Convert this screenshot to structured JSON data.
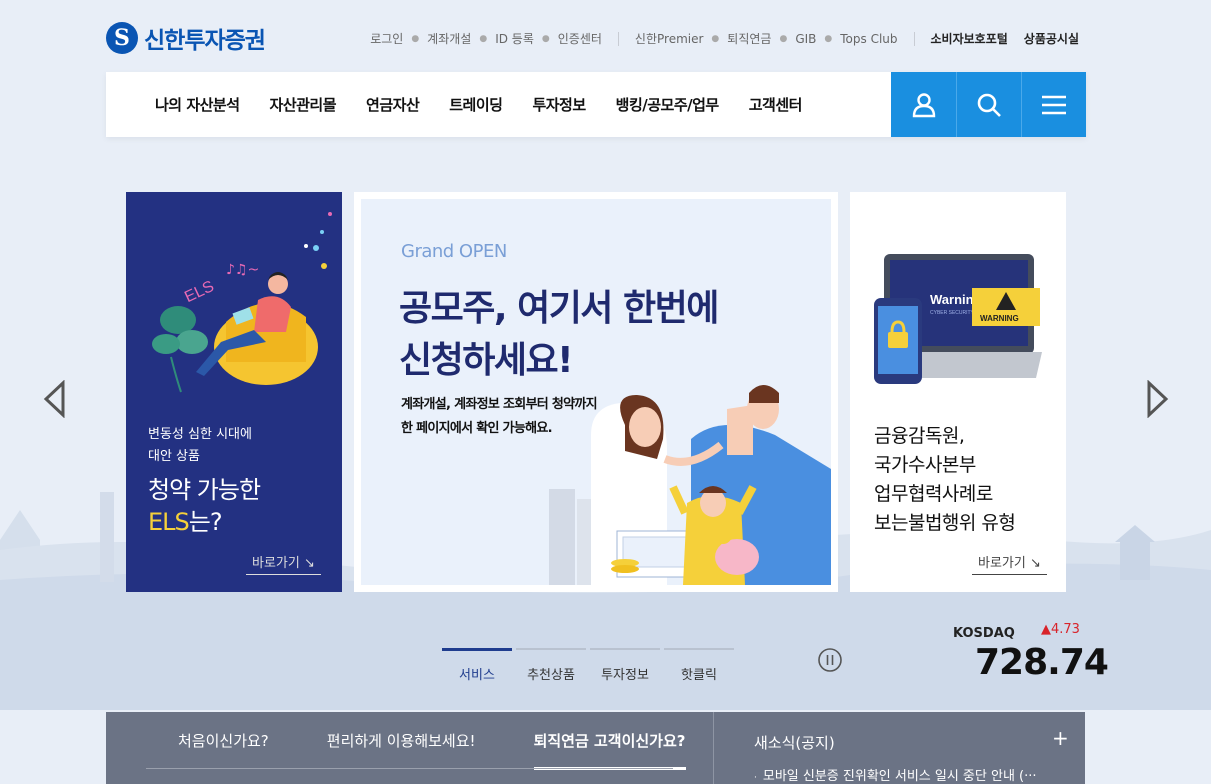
{
  "brand": {
    "logo_mark": "S",
    "name": "신한투자증권"
  },
  "util_links": [
    "로그인",
    "계좌개설",
    "ID 등록",
    "인증센터"
  ],
  "util_links2": [
    "신한Premier",
    "퇴직연금",
    "GIB",
    "Tops Club"
  ],
  "util_strong": [
    "소비자보호포털",
    "상품공시실"
  ],
  "gnb": {
    "menu": [
      "나의 자산분석",
      "자산관리몰",
      "연금자산",
      "트레이딩",
      "투자정보",
      "뱅킹/공모주/업무",
      "고객센터"
    ],
    "buttons": [
      "user-icon",
      "search-icon",
      "menu-icon"
    ]
  },
  "banner_left": {
    "art_text": "ELS",
    "desc1": "변동성 심한 시대에",
    "desc2": "대안 상품",
    "title1": "청약 가능한",
    "title2_highlight": "ELS",
    "title2_rest": "는?",
    "link": "바로가기"
  },
  "banner_center": {
    "grand": "Grand OPEN",
    "title1": "공모주, 여기서 한번에",
    "title2": "신청하세요!",
    "sub1": "계좌개설, 계좌정보 조회부터 청약까지",
    "sub2": "한 페이지에서 확인 가능해요."
  },
  "banner_right": {
    "screen_text": "Warning",
    "screen_sub": "CYBER SECURITY",
    "warning_label": "WARNING",
    "title1": "금융감독원,",
    "title2": "국가수사본부",
    "title3": "업무협력사례로",
    "title4": "보는불법행위 유형",
    "link": "바로가기"
  },
  "tabs": [
    "서비스",
    "추천상품",
    "투자정보",
    "핫클릭"
  ],
  "active_tab": 0,
  "index": {
    "name": "KOSDAQ",
    "change": "▲4.73",
    "value": "728.74"
  },
  "bottom": {
    "tabs": [
      "처음이신가요?",
      "편리하게 이용해보세요!",
      "퇴직연금 고객이신가요?"
    ],
    "news_title": "새소식(공지)",
    "news_plus": "+",
    "news_bullet": "·",
    "news_item": "모바일 신분증 진위확인 서비스 일시 중단 안내 (···"
  },
  "colors": {
    "brand_blue": "#0a55b3",
    "gnb_button": "#1a8fe0",
    "left_card": "#233182",
    "bottom_panel": "#6b7385",
    "up_red": "#d8232a"
  }
}
